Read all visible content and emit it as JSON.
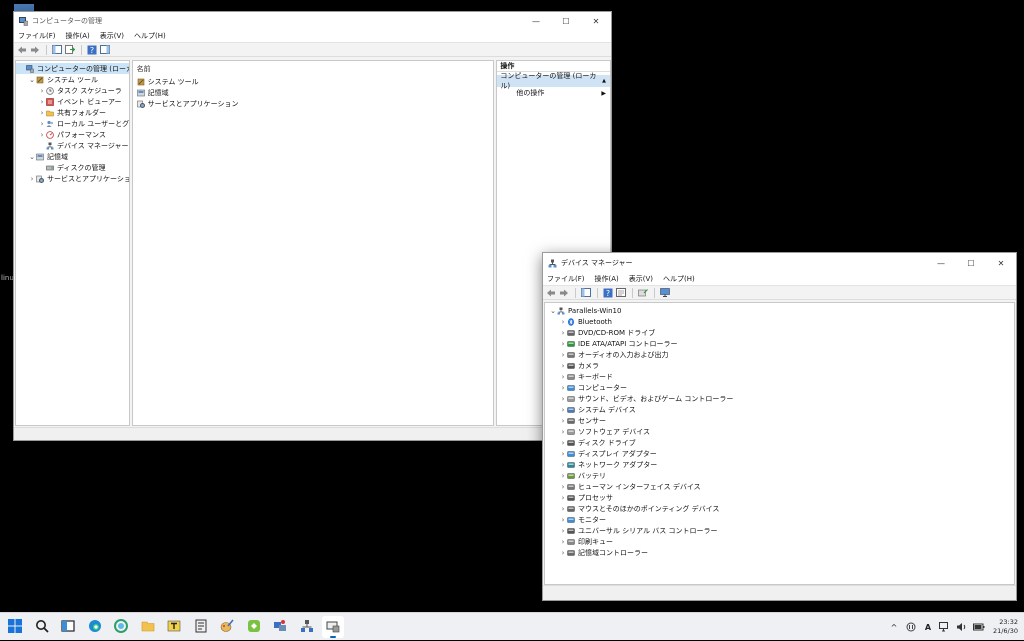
{
  "desktop": {
    "side_label": "linu"
  },
  "computer_management": {
    "title": "コンピューターの管理",
    "window_controls": {
      "minimize": "—",
      "maximize": "☐",
      "close": "✕"
    },
    "menu": [
      "ファイル(F)",
      "操作(A)",
      "表示(V)",
      "ヘルプ(H)"
    ],
    "tree": [
      {
        "label": "コンピューターの管理 (ローカル)",
        "level": 0,
        "chev": "",
        "icon": "computer-management-icon",
        "selected": true
      },
      {
        "label": "システム ツール",
        "level": 1,
        "chev": "⌄",
        "icon": "system-tools-icon"
      },
      {
        "label": "タスク スケジューラ",
        "level": 2,
        "chev": "›",
        "icon": "clock-icon"
      },
      {
        "label": "イベント ビューアー",
        "level": 2,
        "chev": "›",
        "icon": "event-viewer-icon"
      },
      {
        "label": "共有フォルダー",
        "level": 2,
        "chev": "›",
        "icon": "shared-folder-icon"
      },
      {
        "label": "ローカル ユーザーとグループ",
        "level": 2,
        "chev": "›",
        "icon": "users-icon"
      },
      {
        "label": "パフォーマンス",
        "level": 2,
        "chev": "›",
        "icon": "performance-icon"
      },
      {
        "label": "デバイス マネージャー",
        "level": 2,
        "chev": "",
        "icon": "device-manager-icon"
      },
      {
        "label": "記憶域",
        "level": 1,
        "chev": "⌄",
        "icon": "storage-icon"
      },
      {
        "label": "ディスクの管理",
        "level": 2,
        "chev": "",
        "icon": "disk-icon"
      },
      {
        "label": "サービスとアプリケーション",
        "level": 1,
        "chev": "›",
        "icon": "services-icon"
      }
    ],
    "list_header": "名前",
    "list_items": [
      "システム ツール",
      "記憶域",
      "サービスとアプリケーション"
    ],
    "actions": {
      "header": "操作",
      "selected": "コンピューターの管理 (ローカル)",
      "selected_arrow": "▲",
      "item": "他の操作",
      "item_arrow": "▶"
    }
  },
  "device_manager": {
    "title": "デバイス マネージャー",
    "window_controls": {
      "minimize": "—",
      "maximize": "☐",
      "close": "✕"
    },
    "menu": [
      "ファイル(F)",
      "操作(A)",
      "表示(V)",
      "ヘルプ(H)"
    ],
    "root": "Parallels-Win10",
    "root_chev": "⌄",
    "child_chev": "›",
    "categories": [
      "Bluetooth",
      "DVD/CD-ROM ドライブ",
      "IDE ATA/ATAPI コントローラー",
      "オーディオの入力および出力",
      "カメラ",
      "キーボード",
      "コンピューター",
      "サウンド、ビデオ、およびゲーム コントローラー",
      "システム デバイス",
      "センサー",
      "ソフトウェア デバイス",
      "ディスク ドライブ",
      "ディスプレイ アダプター",
      "ネットワーク アダプター",
      "バッテリ",
      "ヒューマン インターフェイス デバイス",
      "プロセッサ",
      "マウスとそのほかのポインティング デバイス",
      "モニター",
      "ユニバーサル シリアル バス コントローラー",
      "印刷キュー",
      "記憶域コントローラー"
    ]
  },
  "taskbar": {
    "tray_chevron": "^",
    "ime_indicator": "A",
    "time": "23:32",
    "date": "21/6/30"
  },
  "colors": {
    "accent": "#0067c0",
    "selection": "#cce4f7",
    "taskbar": "#eef0f3"
  }
}
